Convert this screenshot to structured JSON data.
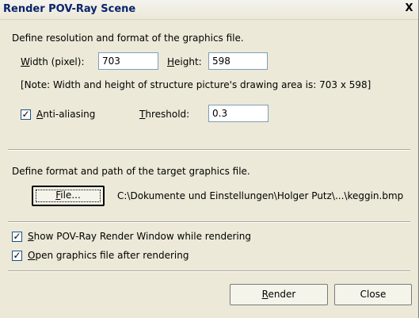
{
  "window": {
    "title": "Render POV-Ray Scene",
    "close_glyph": "X"
  },
  "resolution": {
    "section_label": "Define resolution and format of the graphics file.",
    "width_label_u": "W",
    "width_label_rest": "idth (pixel):",
    "width_value": "703",
    "height_label_u": "H",
    "height_label_rest": "eight:",
    "height_value": "598",
    "note": "[Note: Width and height of structure picture's drawing area is: 703 x 598]",
    "antialias_checked": true,
    "antialias_label_u": "A",
    "antialias_label_rest": "nti-aliasing",
    "threshold_label_u": "T",
    "threshold_label_rest": "hreshold:",
    "threshold_value": "0.3"
  },
  "target": {
    "section_label": "Define format and path of the target graphics file.",
    "file_button_u": "F",
    "file_button_rest": "ile...",
    "path": "C:\\Dokumente und Einstellungen\\Holger Putz\\...\\keggin.bmp"
  },
  "options": {
    "show_window_checked": true,
    "show_window_u": "S",
    "show_window_rest": "how POV-Ray Render Window while rendering",
    "open_file_checked": true,
    "open_file_u": "O",
    "open_file_rest": "pen graphics file after rendering"
  },
  "buttons": {
    "render_u": "R",
    "render_rest": "ender",
    "close": "Close"
  },
  "check_glyph": "✓"
}
